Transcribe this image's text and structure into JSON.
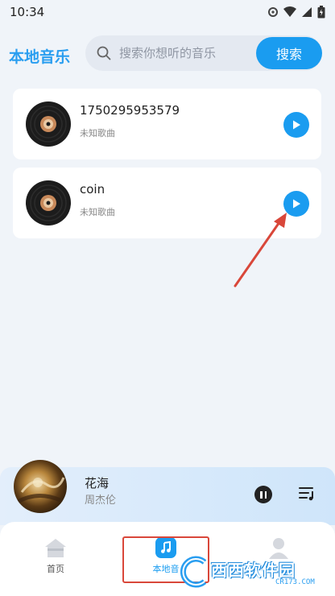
{
  "status_bar": {
    "time": "10:34"
  },
  "header": {
    "title": "本地音乐",
    "search_placeholder": "搜索你想听的音乐",
    "search_button": "搜索"
  },
  "songs": [
    {
      "title": "1750295953579",
      "artist": "未知歌曲"
    },
    {
      "title": "coin",
      "artist": "未知歌曲"
    }
  ],
  "now_playing": {
    "title": "花海",
    "artist": "周杰伦"
  },
  "tabs": [
    {
      "label": "首页",
      "icon": "home-icon"
    },
    {
      "label": "本地音",
      "icon": "music-note-icon",
      "active": true
    },
    {
      "label": "",
      "icon": "person-icon"
    }
  ],
  "watermark": {
    "text": "西西软件园",
    "sub": "CR173.COM"
  },
  "colors": {
    "accent": "#1a9cf0",
    "title_blue": "#2a9ef0",
    "annotation_red": "#d9473a",
    "background": "#f0f4f9"
  }
}
